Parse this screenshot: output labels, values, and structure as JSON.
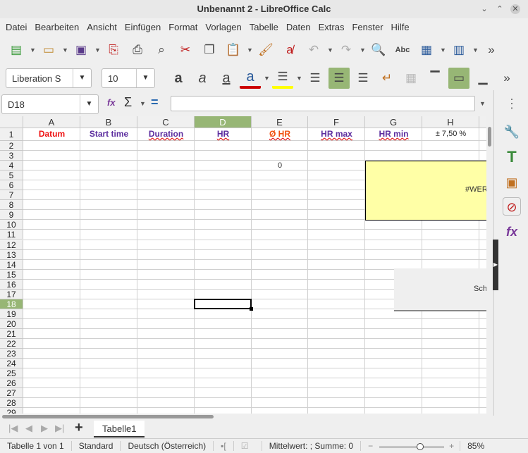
{
  "window": {
    "title": "Unbenannt 2 - LibreOffice Calc",
    "minimize": "⌄",
    "maximize": "⌃",
    "close": "✕"
  },
  "menu": [
    "Datei",
    "Bearbeiten",
    "Ansicht",
    "Einfügen",
    "Format",
    "Vorlagen",
    "Tabelle",
    "Daten",
    "Extras",
    "Fenster",
    "Hilfe"
  ],
  "toolbar2": {
    "font_name": "Liberation S",
    "font_size": "10"
  },
  "formula_bar": {
    "name_box": "D18",
    "fx": "fx",
    "sigma": "Σ",
    "equals": "=",
    "content": ""
  },
  "columns": [
    "A",
    "B",
    "C",
    "D",
    "E",
    "F",
    "G",
    "H"
  ],
  "selected_column": "D",
  "selected_row": 18,
  "rows": [
    "1",
    "2",
    "3",
    "4",
    "5",
    "6",
    "7",
    "8",
    "9",
    "10",
    "11",
    "12",
    "13",
    "14",
    "15",
    "16",
    "17",
    "18",
    "19",
    "20",
    "21",
    "22",
    "23",
    "24",
    "25",
    "26",
    "27",
    "28",
    "29"
  ],
  "row1": [
    {
      "text": "Datum",
      "color": "#ee1111",
      "squiggle": false
    },
    {
      "text": "Start time",
      "color": "#5b2c9e",
      "squiggle": false
    },
    {
      "text": "Duration",
      "color": "#5b2c9e",
      "squiggle": true
    },
    {
      "text": "HR",
      "color": "#5b2c9e",
      "squiggle": true
    },
    {
      "text": "Ø HR",
      "color": "#f05010",
      "squiggle": true
    },
    {
      "text": "HR max",
      "color": "#5b2c9e",
      "squiggle": true
    },
    {
      "text": "HR min",
      "color": "#5b2c9e",
      "squiggle": true
    },
    {
      "text": "± 7,50  %",
      "color": "#222222",
      "squiggle": false
    }
  ],
  "e4": "0",
  "yellow_box": {
    "text": "#WER",
    "color": "#ffffa6"
  },
  "gray_button": {
    "text": "Sch"
  },
  "sheet_tabs": {
    "add": "+",
    "tabs": [
      "Tabelle1"
    ]
  },
  "status": {
    "sheet": "Tabelle 1 von 1",
    "style": "Standard",
    "language": "Deutsch (Österreich)",
    "sum": "Mittelwert: ; Summe: 0",
    "zoom": "85%",
    "zoom_level": 85
  }
}
